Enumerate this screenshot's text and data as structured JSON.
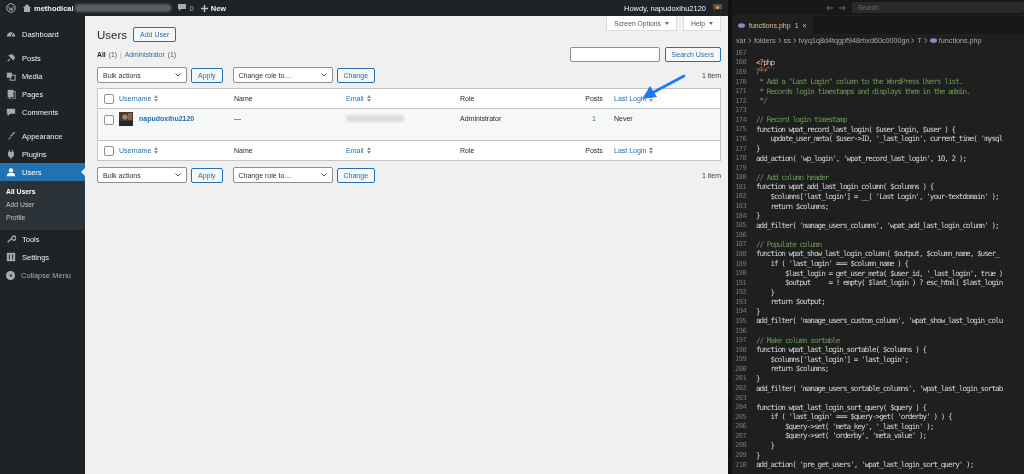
{
  "admin_bar": {
    "site_name": "methodical",
    "comments_count": "0",
    "new_label": "New",
    "greeting": "Howdy, napudoxihu2120"
  },
  "sidebar": {
    "items": [
      {
        "label": "Dashboard",
        "selected": false
      },
      {
        "label": "Posts",
        "selected": false
      },
      {
        "label": "Media",
        "selected": false
      },
      {
        "label": "Pages",
        "selected": false
      },
      {
        "label": "Comments",
        "selected": false
      },
      {
        "label": "Appearance",
        "selected": false
      },
      {
        "label": "Plugins",
        "selected": false
      },
      {
        "label": "Users",
        "selected": true,
        "children": [
          {
            "label": "All Users",
            "selected": true
          },
          {
            "label": "Add User",
            "selected": false
          },
          {
            "label": "Profile",
            "selected": false
          }
        ]
      },
      {
        "label": "Tools",
        "selected": false
      },
      {
        "label": "Settings",
        "selected": false
      }
    ],
    "collapse_label": "Collapse Menu"
  },
  "page": {
    "title": "Users",
    "add_button": "Add User",
    "screen_options": "Screen Options",
    "help": "Help",
    "filter_separator": "|",
    "filters": [
      {
        "label": "All",
        "count": "(1)",
        "selected": true
      },
      {
        "label": "Administrator",
        "count": "(1)",
        "selected": false
      }
    ],
    "search_button": "Search Users",
    "tablenav_top": {
      "bulk": "Bulk actions",
      "apply": "Apply",
      "role": "Change role to…",
      "change": "Change",
      "count": "1 item"
    },
    "table_header": {
      "checked": false,
      "columns": [
        {
          "label": "Username",
          "sortable": true
        },
        {
          "label": "Name",
          "sortable": false
        },
        {
          "label": "Email",
          "sortable": true
        },
        {
          "label": "Role",
          "sortable": false
        },
        {
          "label": "Posts",
          "sortable": false
        },
        {
          "label": "Last Login",
          "sortable": true
        }
      ]
    },
    "rows": [
      {
        "checked": false,
        "username": "napudoxihu2120",
        "name": "—",
        "role": "Administrator",
        "posts": "1",
        "last_login": "Never"
      }
    ],
    "table_footer": {
      "checked": false,
      "columns": [
        {
          "label": "Username",
          "sortable": true
        },
        {
          "label": "Name",
          "sortable": false
        },
        {
          "label": "Email",
          "sortable": true
        },
        {
          "label": "Role",
          "sortable": false
        },
        {
          "label": "Posts",
          "sortable": false
        },
        {
          "label": "Last Login",
          "sortable": true
        }
      ]
    },
    "tablenav_bottom": {
      "bulk": "Bulk actions",
      "apply": "Apply",
      "role": "Change role to…",
      "change": "Change",
      "count": "1 item"
    }
  },
  "editor": {
    "search_placeholder": "Search",
    "tab": {
      "title": "functions.php",
      "problems": "1",
      "close": "×"
    },
    "breadcrumb": [
      "var",
      "folders",
      "ss",
      "tvyq1q8d4tqgpf948rhxd60c0000gn",
      "T",
      "functions.php"
    ],
    "lines": [
      {
        "n": "167"
      },
      {
        "n": "168",
        "text": "<?php",
        "kind": "tag"
      },
      {
        "n": "169",
        "text": "/**",
        "kind": "comment"
      },
      {
        "n": "170",
        "text": " * Add a \"Last Login\" column to the WordPress Users list.",
        "kind": "comment"
      },
      {
        "n": "171",
        "text": " * Records login timestamps and displays them in the admin.",
        "kind": "comment"
      },
      {
        "n": "172",
        "text": " */",
        "kind": "comment"
      },
      {
        "n": "173"
      },
      {
        "n": "174",
        "text": "// Record login timestamp",
        "kind": "comment"
      },
      {
        "n": "175",
        "text": "function wpat_record_last_login( $user_login, $user ) {",
        "kind": "code"
      },
      {
        "n": "176",
        "text": "    update_user_meta( $user->ID, '_last_login', current_time( 'mysql",
        "kind": "code"
      },
      {
        "n": "177",
        "text": "}",
        "kind": "code"
      },
      {
        "n": "178",
        "text": "add_action( 'wp_login', 'wpat_record_last_login', 10, 2 );",
        "kind": "code"
      },
      {
        "n": "179"
      },
      {
        "n": "180",
        "text": "// Add column header",
        "kind": "comment"
      },
      {
        "n": "181",
        "text": "function wpat_add_last_login_column( $columns ) {",
        "kind": "code"
      },
      {
        "n": "182",
        "text": "    $columns['last_login'] = __( 'Last Login', 'your-textdomain' );",
        "kind": "code"
      },
      {
        "n": "183",
        "text": "    return $columns;",
        "kind": "code"
      },
      {
        "n": "184",
        "text": "}",
        "kind": "code"
      },
      {
        "n": "185",
        "text": "add_filter( 'manage_users_columns', 'wpat_add_last_login_column' );",
        "kind": "code"
      },
      {
        "n": "186"
      },
      {
        "n": "187",
        "text": "// Populate column",
        "kind": "comment"
      },
      {
        "n": "188",
        "text": "function wpat_show_last_login_column( $output, $column_name, $user_",
        "kind": "code"
      },
      {
        "n": "189",
        "text": "    if ( 'last_login' === $column_name ) {",
        "kind": "code"
      },
      {
        "n": "190",
        "text": "        $last_login = get_user_meta( $user_id, '_last_login', true )",
        "kind": "code"
      },
      {
        "n": "191",
        "text": "        $output     = ! empty( $last_login ) ? esc_html( $last_login",
        "kind": "code"
      },
      {
        "n": "192",
        "text": "    }",
        "kind": "code"
      },
      {
        "n": "193",
        "text": "    return $output;",
        "kind": "code"
      },
      {
        "n": "194",
        "text": "}",
        "kind": "code"
      },
      {
        "n": "195",
        "text": "add_filter( 'manage_users_custom_column', 'wpat_show_last_login_colu",
        "kind": "code"
      },
      {
        "n": "196"
      },
      {
        "n": "197",
        "text": "// Make column sortable",
        "kind": "comment"
      },
      {
        "n": "198",
        "text": "function wpat_last_login_sortable( $columns ) {",
        "kind": "code"
      },
      {
        "n": "199",
        "text": "    $columns['last_login'] = 'last_login';",
        "kind": "code"
      },
      {
        "n": "200",
        "text": "    return $columns;",
        "kind": "code"
      },
      {
        "n": "201",
        "text": "}",
        "kind": "code"
      },
      {
        "n": "202",
        "text": "add_filter( 'manage_users_sortable_columns', 'wpat_last_login_sortab",
        "kind": "code"
      },
      {
        "n": "203"
      },
      {
        "n": "204",
        "text": "function wpat_last_login_sort_query( $query ) {",
        "kind": "code"
      },
      {
        "n": "205",
        "text": "    if ( 'last_login' === $query->get( 'orderby' ) ) {",
        "kind": "code"
      },
      {
        "n": "206",
        "text": "        $query->set( 'meta_key', '_last_login' );",
        "kind": "code"
      },
      {
        "n": "207",
        "text": "        $query->set( 'orderby', 'meta_value' );",
        "kind": "code"
      },
      {
        "n": "208",
        "text": "    }",
        "kind": "code"
      },
      {
        "n": "209",
        "text": "}",
        "kind": "code"
      },
      {
        "n": "210",
        "text": "add_action( 'pre_get_users', 'wpat_last_login_sort_query' );",
        "kind": "code"
      }
    ]
  }
}
